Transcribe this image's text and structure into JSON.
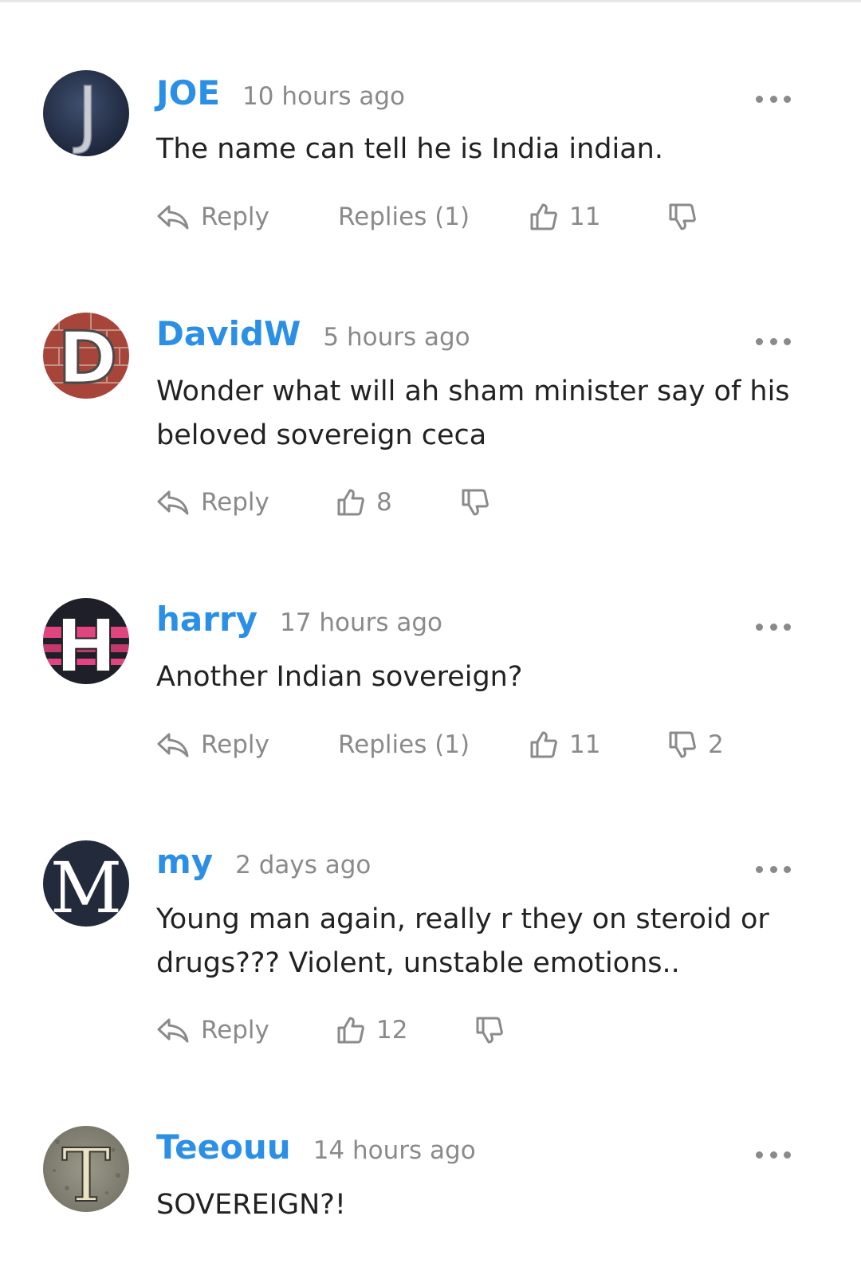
{
  "comments": [
    {
      "avatar_letter": "J",
      "username": "JOE",
      "timestamp": "10 hours ago",
      "text": "The name can tell he is India indian.",
      "reply_label": "Reply",
      "replies_label": "Replies (1)",
      "likes": "11",
      "dislikes": ""
    },
    {
      "avatar_letter": "D",
      "username": "DavidW",
      "timestamp": "5 hours ago",
      "text": "Wonder what will ah sham minister say of his beloved sovereign ceca",
      "reply_label": "Reply",
      "replies_label": "",
      "likes": "8",
      "dislikes": ""
    },
    {
      "avatar_letter": "H",
      "username": "harry",
      "timestamp": "17 hours ago",
      "text": "Another Indian sovereign?",
      "reply_label": "Reply",
      "replies_label": "Replies (1)",
      "likes": "11",
      "dislikes": "2"
    },
    {
      "avatar_letter": "M",
      "username": "my",
      "timestamp": "2 days ago",
      "text": "Young man again, really r they on steroid or drugs??? Violent, unstable emotions..",
      "reply_label": "Reply",
      "replies_label": "",
      "likes": "12",
      "dislikes": ""
    },
    {
      "avatar_letter": "T",
      "username": "Teeouu",
      "timestamp": "14 hours ago",
      "text": "SOVEREIGN?!",
      "reply_label": "",
      "replies_label": "",
      "likes": "",
      "dislikes": ""
    }
  ],
  "icons": {
    "reply": "reply-arrow-icon",
    "like": "thumbs-up-icon",
    "dislike": "thumbs-down-icon",
    "more": "more-dots-icon"
  },
  "colors": {
    "username": "#2b8fe6",
    "meta": "#8a8a8a",
    "text": "#222222"
  }
}
